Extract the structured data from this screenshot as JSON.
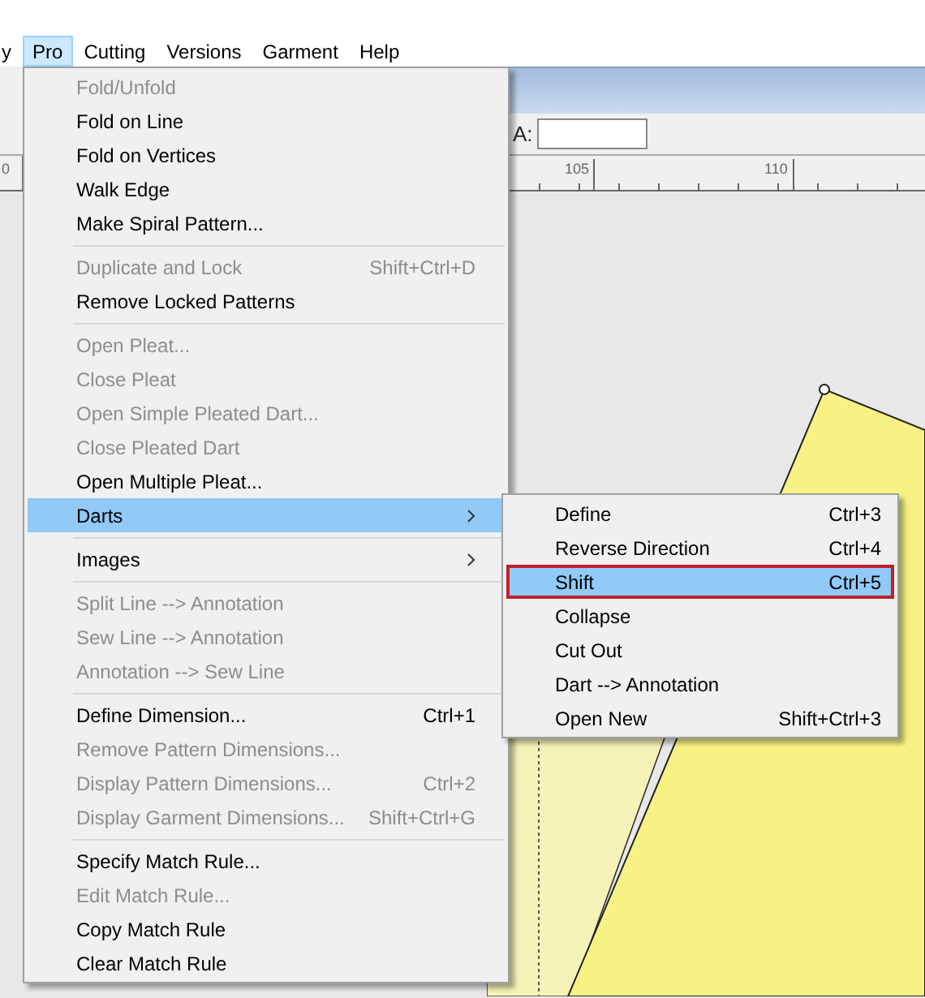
{
  "menubar": [
    {
      "label": "y",
      "selected": false
    },
    {
      "label": "Pro",
      "selected": true
    },
    {
      "label": "Cutting",
      "selected": false
    },
    {
      "label": "Versions",
      "selected": false
    },
    {
      "label": "Garment",
      "selected": false
    },
    {
      "label": "Help",
      "selected": false
    }
  ],
  "toolbar": {
    "field_label": "A:"
  },
  "ruler": {
    "labels": [
      "0",
      "105",
      "110"
    ]
  },
  "menu": [
    {
      "kind": "item",
      "label": "Fold/Unfold",
      "disabled": true,
      "selected": false
    },
    {
      "kind": "item",
      "label": "Fold on Line",
      "disabled": false,
      "selected": false
    },
    {
      "kind": "item",
      "label": "Fold on Vertices",
      "disabled": false,
      "selected": false
    },
    {
      "kind": "item",
      "label": "Walk Edge",
      "disabled": false,
      "selected": false
    },
    {
      "kind": "item",
      "label": "Make Spiral Pattern...",
      "disabled": false,
      "selected": false
    },
    {
      "kind": "separator"
    },
    {
      "kind": "item",
      "label": "Duplicate and Lock",
      "shortcut": "Shift+Ctrl+D",
      "disabled": true,
      "selected": false
    },
    {
      "kind": "item",
      "label": "Remove Locked Patterns",
      "disabled": false,
      "selected": false
    },
    {
      "kind": "separator"
    },
    {
      "kind": "item",
      "label": "Open Pleat...",
      "disabled": true,
      "selected": false
    },
    {
      "kind": "item",
      "label": "Close Pleat",
      "disabled": true,
      "selected": false
    },
    {
      "kind": "item",
      "label": "Open Simple Pleated Dart...",
      "disabled": true,
      "selected": false
    },
    {
      "kind": "item",
      "label": "Close Pleated Dart",
      "disabled": true,
      "selected": false
    },
    {
      "kind": "item",
      "label": "Open Multiple Pleat...",
      "disabled": false,
      "selected": false
    },
    {
      "kind": "item",
      "label": "Darts",
      "disabled": false,
      "selected": true,
      "submenu": true
    },
    {
      "kind": "separator"
    },
    {
      "kind": "item",
      "label": "Images",
      "disabled": false,
      "selected": false,
      "submenu": true
    },
    {
      "kind": "separator"
    },
    {
      "kind": "item",
      "label": "Split Line --> Annotation",
      "disabled": true,
      "selected": false
    },
    {
      "kind": "item",
      "label": "Sew Line --> Annotation",
      "disabled": true,
      "selected": false
    },
    {
      "kind": "item",
      "label": "Annotation --> Sew Line",
      "disabled": true,
      "selected": false
    },
    {
      "kind": "separator"
    },
    {
      "kind": "item",
      "label": "Define Dimension...",
      "shortcut": "Ctrl+1",
      "disabled": false,
      "selected": false
    },
    {
      "kind": "item",
      "label": "Remove Pattern Dimensions...",
      "disabled": true,
      "selected": false
    },
    {
      "kind": "item",
      "label": "Display Pattern Dimensions...",
      "shortcut": "Ctrl+2",
      "disabled": true,
      "selected": false
    },
    {
      "kind": "item",
      "label": "Display Garment Dimensions...",
      "shortcut": "Shift+Ctrl+G",
      "disabled": true,
      "selected": false
    },
    {
      "kind": "separator"
    },
    {
      "kind": "item",
      "label": "Specify Match Rule...",
      "disabled": false,
      "selected": false
    },
    {
      "kind": "item",
      "label": "Edit Match Rule...",
      "disabled": true,
      "selected": false
    },
    {
      "kind": "item",
      "label": "Copy Match Rule",
      "disabled": false,
      "selected": false
    },
    {
      "kind": "item",
      "label": "Clear Match Rule",
      "disabled": false,
      "selected": false
    }
  ],
  "submenu": [
    {
      "label": "Define",
      "shortcut": "Ctrl+3",
      "selected": false,
      "outlined": false
    },
    {
      "label": "Reverse Direction",
      "shortcut": "Ctrl+4",
      "selected": false,
      "outlined": false
    },
    {
      "label": "Shift",
      "shortcut": "Ctrl+5",
      "selected": true,
      "outlined": true
    },
    {
      "label": "Collapse",
      "selected": false,
      "outlined": false
    },
    {
      "label": "Cut Out",
      "selected": false,
      "outlined": false
    },
    {
      "label": "Dart --> Annotation",
      "selected": false,
      "outlined": false
    },
    {
      "label": "Open New",
      "shortcut": "Shift+Ctrl+3",
      "selected": false,
      "outlined": false
    }
  ]
}
